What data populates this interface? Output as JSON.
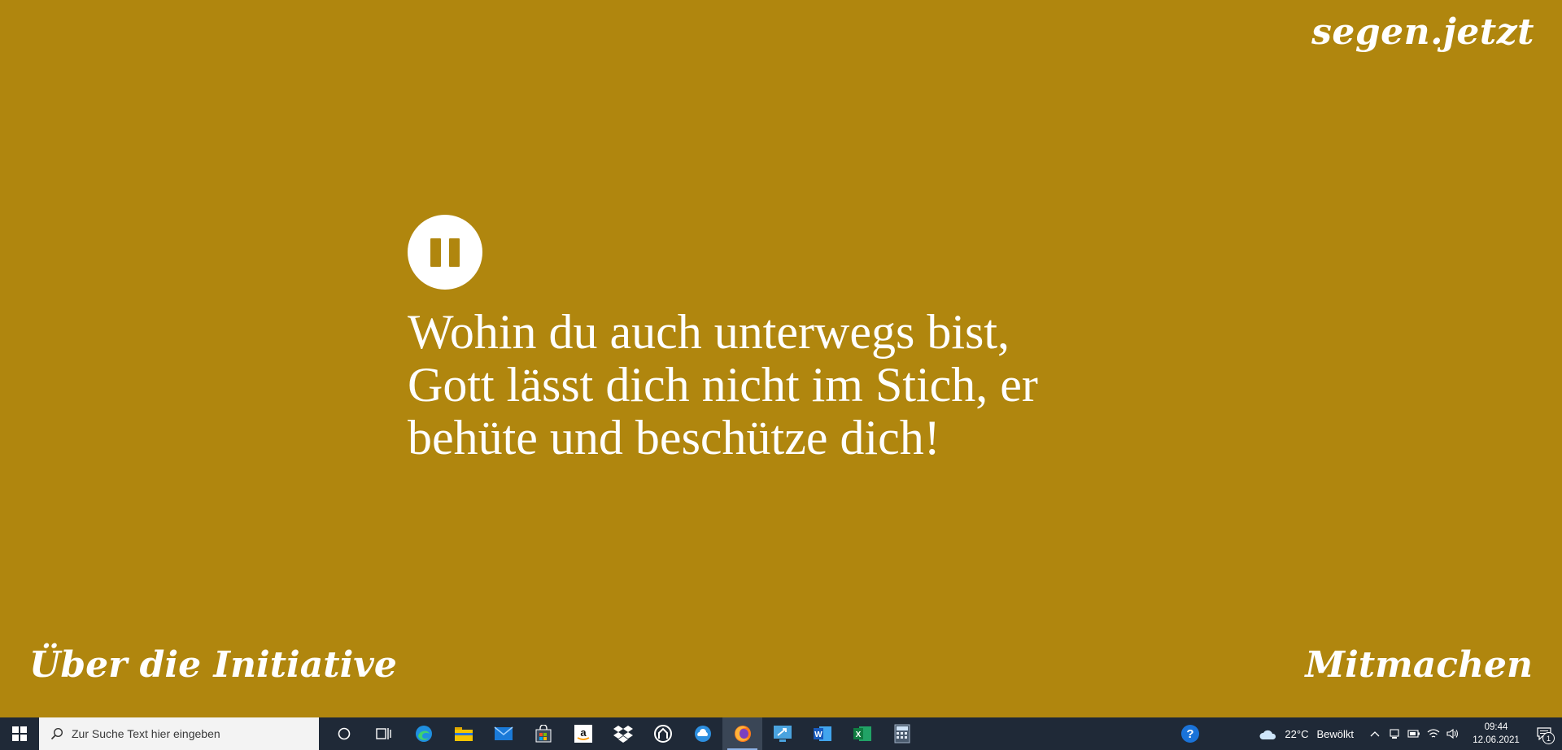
{
  "site": {
    "logo": "segen.jetzt",
    "blessing_lines": [
      "Wohin du auch unterwegs bist,",
      "Gott lässt dich nicht im Stich, er",
      "behüte und beschütze dich!"
    ],
    "footer_left": "Über die Initiative",
    "footer_right": "Mitmachen",
    "background_color": "#B0860E",
    "player_icon": "pause-icon"
  },
  "taskbar": {
    "search_placeholder": "Zur Suche Text hier eingeben",
    "pinned_icons": [
      "cortana-icon",
      "task-view-icon",
      "edge-icon",
      "file-explorer-icon",
      "mail-icon",
      "store-icon",
      "amazon-icon",
      "dropbox-icon",
      "app-icon",
      "cloud-app-icon",
      "firefox-icon",
      "remote-desktop-icon",
      "word-icon",
      "excel-icon",
      "calculator-icon"
    ],
    "active_icon": "firefox-icon",
    "weather_temp": "22°C",
    "weather_desc": "Bewölkt",
    "time": "09:44",
    "date": "12.06.2021",
    "notification_count": "1"
  }
}
